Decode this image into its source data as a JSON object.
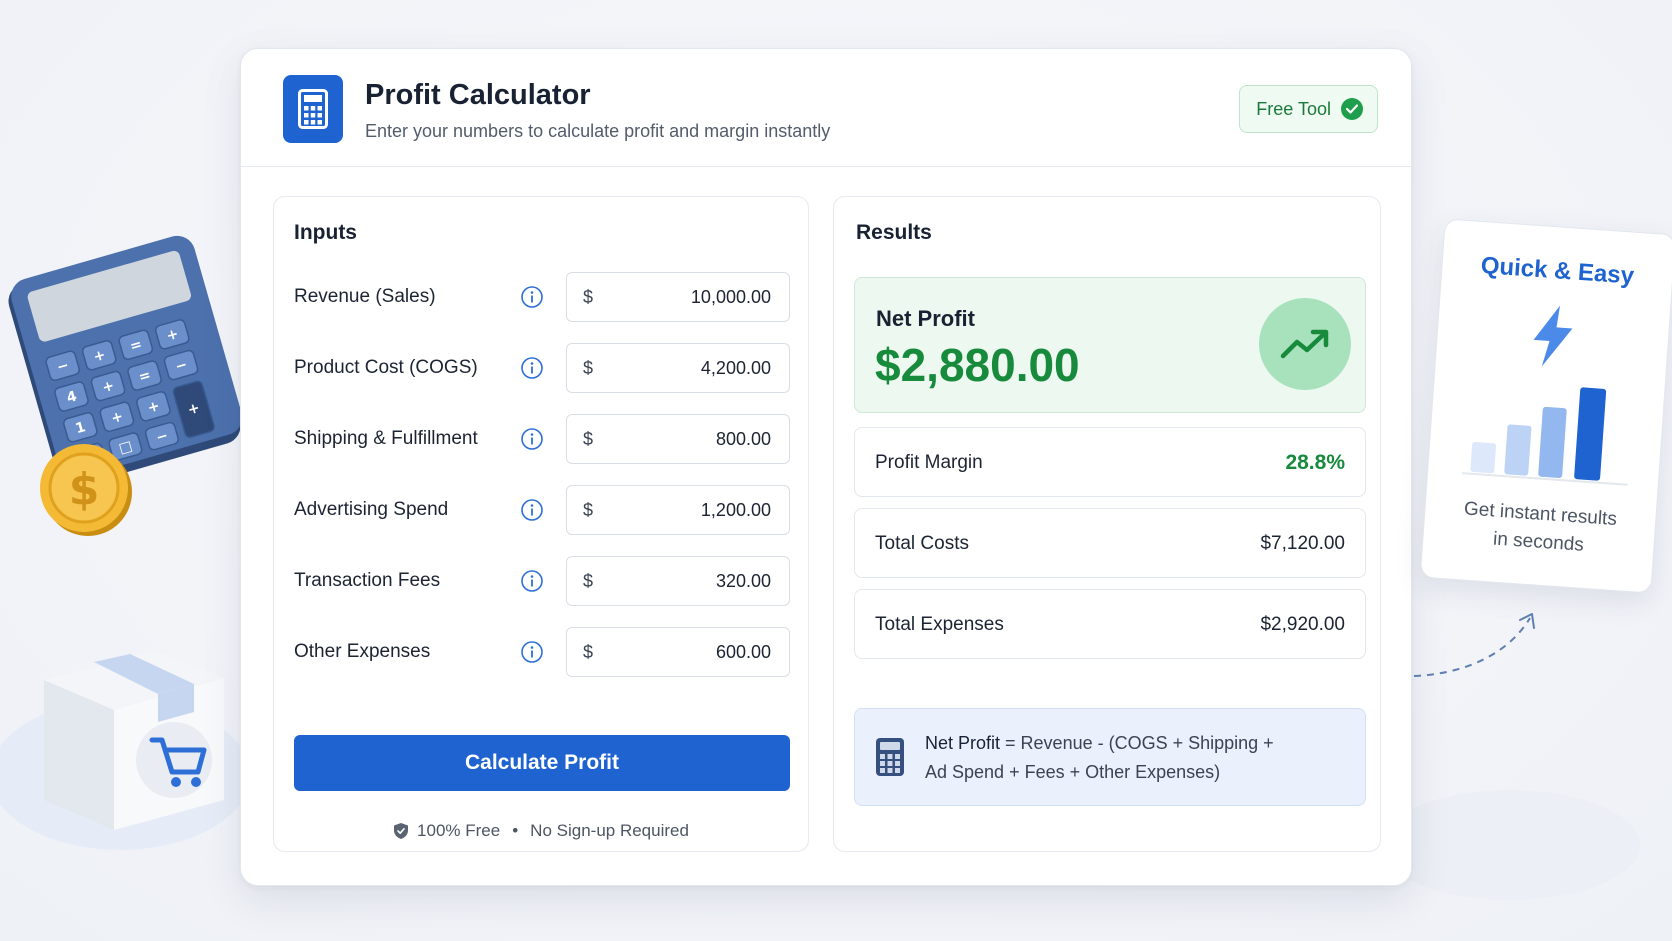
{
  "header": {
    "title": "Profit Calculator",
    "subtitle": "Enter your numbers to calculate profit and margin instantly",
    "badge_label": "Free Tool"
  },
  "inputs": {
    "title": "Inputs",
    "currency_symbol": "$",
    "rows": [
      {
        "label": "Revenue (Sales)",
        "value": "10,000.00"
      },
      {
        "label": "Product Cost (COGS)",
        "value": "4,200.00"
      },
      {
        "label": "Shipping & Fulfillment",
        "value": "800.00"
      },
      {
        "label": "Advertising Spend",
        "value": "1,200.00"
      },
      {
        "label": "Transaction Fees",
        "value": "320.00"
      },
      {
        "label": "Other Expenses",
        "value": "600.00"
      }
    ],
    "button_label": "Calculate Profit",
    "footnote_left": "100% Free",
    "footnote_separator": "•",
    "footnote_right": "No Sign-up Required"
  },
  "results": {
    "title": "Results",
    "net_profit_label": "Net Profit",
    "net_profit_value": "$2,880.00",
    "rows": [
      {
        "label": "Profit Margin",
        "value": "28.8%"
      },
      {
        "label": "Total Costs",
        "value": "$7,120.00"
      },
      {
        "label": "Total Expenses",
        "value": "$2,920.00"
      }
    ],
    "formula_lead": "Net Profit",
    "formula_line1": " = Revenue - (COGS + Shipping +",
    "formula_line2": "Ad Spend + Fees + Other Expenses)"
  },
  "promo": {
    "title": "Quick & Easy",
    "line1": "Get instant results",
    "line2": "in seconds"
  },
  "icons": {
    "app": "calculator-icon",
    "badge": "check-circle-icon",
    "info": "info-icon",
    "net_profit": "trend-up-icon",
    "footnote": "shield-icon",
    "formula": "calculator-icon",
    "promo": "lightning-bolt-icon"
  },
  "colors": {
    "primary": "#1e63cf",
    "success": "#178a3c",
    "success_bg": "#edf8f0",
    "formula_bg": "#eaf1fc"
  }
}
